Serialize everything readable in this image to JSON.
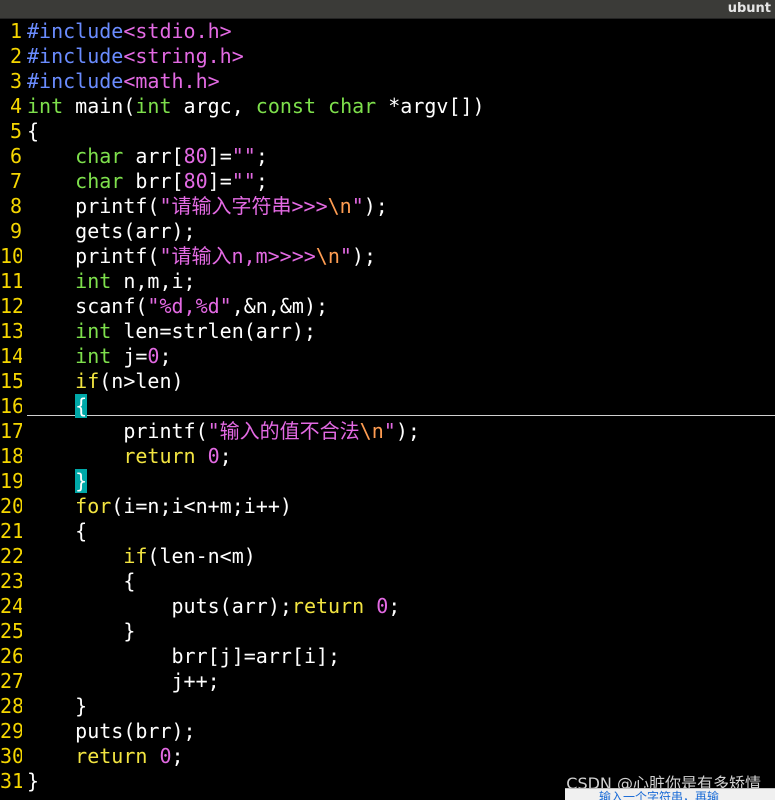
{
  "window": {
    "title": "ubunt"
  },
  "editor": {
    "lines": [
      {
        "num": "1",
        "tokens": [
          {
            "t": "pre",
            "v": "#include"
          },
          {
            "t": "inc",
            "v": "<stdio.h>"
          }
        ]
      },
      {
        "num": "2",
        "tokens": [
          {
            "t": "pre",
            "v": "#include"
          },
          {
            "t": "inc",
            "v": "<string.h>"
          }
        ]
      },
      {
        "num": "3",
        "tokens": [
          {
            "t": "pre",
            "v": "#include"
          },
          {
            "t": "inc",
            "v": "<math.h>"
          }
        ]
      },
      {
        "num": "4",
        "tokens": [
          {
            "t": "type",
            "v": "int"
          },
          {
            "t": "id",
            "v": " main("
          },
          {
            "t": "type",
            "v": "int"
          },
          {
            "t": "id",
            "v": " argc, "
          },
          {
            "t": "type",
            "v": "const char"
          },
          {
            "t": "id",
            "v": " *argv[])"
          }
        ]
      },
      {
        "num": "5",
        "tokens": [
          {
            "t": "id",
            "v": "{"
          }
        ]
      },
      {
        "num": "6",
        "tokens": [
          {
            "t": "id",
            "v": "    "
          },
          {
            "t": "type",
            "v": "char"
          },
          {
            "t": "id",
            "v": " arr["
          },
          {
            "t": "num",
            "v": "80"
          },
          {
            "t": "id",
            "v": "]="
          },
          {
            "t": "str",
            "v": "\"\""
          },
          {
            "t": "id",
            "v": ";"
          }
        ]
      },
      {
        "num": "7",
        "tokens": [
          {
            "t": "id",
            "v": "    "
          },
          {
            "t": "type",
            "v": "char"
          },
          {
            "t": "id",
            "v": " brr["
          },
          {
            "t": "num",
            "v": "80"
          },
          {
            "t": "id",
            "v": "]="
          },
          {
            "t": "str",
            "v": "\"\""
          },
          {
            "t": "id",
            "v": ";"
          }
        ]
      },
      {
        "num": "8",
        "tokens": [
          {
            "t": "id",
            "v": "    printf("
          },
          {
            "t": "str",
            "v": "\"请输入字符串>>>"
          },
          {
            "t": "esc",
            "v": "\\n"
          },
          {
            "t": "str",
            "v": "\""
          },
          {
            "t": "id",
            "v": ");"
          }
        ]
      },
      {
        "num": "9",
        "tokens": [
          {
            "t": "id",
            "v": "    gets(arr);"
          }
        ]
      },
      {
        "num": "10",
        "tokens": [
          {
            "t": "id",
            "v": "    printf("
          },
          {
            "t": "str",
            "v": "\"请输入n,m>>>>"
          },
          {
            "t": "esc",
            "v": "\\n"
          },
          {
            "t": "str",
            "v": "\""
          },
          {
            "t": "id",
            "v": ");"
          }
        ]
      },
      {
        "num": "11",
        "tokens": [
          {
            "t": "id",
            "v": "    "
          },
          {
            "t": "type",
            "v": "int"
          },
          {
            "t": "id",
            "v": " n,m,i;"
          }
        ]
      },
      {
        "num": "12",
        "tokens": [
          {
            "t": "id",
            "v": "    scanf("
          },
          {
            "t": "str",
            "v": "\"%d,%d\""
          },
          {
            "t": "id",
            "v": ",&n,&m);"
          }
        ]
      },
      {
        "num": "13",
        "tokens": [
          {
            "t": "id",
            "v": "    "
          },
          {
            "t": "type",
            "v": "int"
          },
          {
            "t": "id",
            "v": " len=strlen(arr);"
          }
        ]
      },
      {
        "num": "14",
        "tokens": [
          {
            "t": "id",
            "v": "    "
          },
          {
            "t": "type",
            "v": "int"
          },
          {
            "t": "id",
            "v": " j="
          },
          {
            "t": "num",
            "v": "0"
          },
          {
            "t": "id",
            "v": ";"
          }
        ]
      },
      {
        "num": "15",
        "tokens": [
          {
            "t": "id",
            "v": "    "
          },
          {
            "t": "kw",
            "v": "if"
          },
          {
            "t": "id",
            "v": "(n>len)"
          }
        ]
      },
      {
        "num": "16",
        "tokens": [
          {
            "t": "id",
            "v": "    "
          },
          {
            "t": "brace",
            "v": "{"
          }
        ]
      },
      {
        "num": "17",
        "tokens": [
          {
            "t": "id",
            "v": "        printf("
          },
          {
            "t": "str",
            "v": "\"输入的值不合法"
          },
          {
            "t": "esc",
            "v": "\\n"
          },
          {
            "t": "str",
            "v": "\""
          },
          {
            "t": "id",
            "v": ");"
          }
        ]
      },
      {
        "num": "18",
        "tokens": [
          {
            "t": "id",
            "v": "        "
          },
          {
            "t": "kw",
            "v": "return"
          },
          {
            "t": "id",
            "v": " "
          },
          {
            "t": "num",
            "v": "0"
          },
          {
            "t": "id",
            "v": ";"
          }
        ]
      },
      {
        "num": "19",
        "tokens": [
          {
            "t": "id",
            "v": "    "
          },
          {
            "t": "brace",
            "v": "}"
          }
        ]
      },
      {
        "num": "20",
        "tokens": [
          {
            "t": "id",
            "v": "    "
          },
          {
            "t": "kw",
            "v": "for"
          },
          {
            "t": "id",
            "v": "(i=n;i<n+m;i++)"
          }
        ]
      },
      {
        "num": "21",
        "tokens": [
          {
            "t": "id",
            "v": "    {"
          }
        ]
      },
      {
        "num": "22",
        "tokens": [
          {
            "t": "id",
            "v": "        "
          },
          {
            "t": "kw",
            "v": "if"
          },
          {
            "t": "id",
            "v": "(len-n<m)"
          }
        ]
      },
      {
        "num": "23",
        "tokens": [
          {
            "t": "id",
            "v": "        {"
          }
        ]
      },
      {
        "num": "24",
        "tokens": [
          {
            "t": "id",
            "v": "            puts(arr);"
          },
          {
            "t": "kw",
            "v": "return"
          },
          {
            "t": "id",
            "v": " "
          },
          {
            "t": "num",
            "v": "0"
          },
          {
            "t": "id",
            "v": ";"
          }
        ]
      },
      {
        "num": "25",
        "tokens": [
          {
            "t": "id",
            "v": "        }"
          }
        ]
      },
      {
        "num": "26",
        "tokens": [
          {
            "t": "id",
            "v": "            brr[j]=arr[i];"
          }
        ]
      },
      {
        "num": "27",
        "tokens": [
          {
            "t": "id",
            "v": "            j++;"
          }
        ]
      },
      {
        "num": "28",
        "tokens": [
          {
            "t": "id",
            "v": "    }"
          }
        ]
      },
      {
        "num": "29",
        "tokens": [
          {
            "t": "id",
            "v": "    puts(brr);"
          }
        ]
      },
      {
        "num": "30",
        "tokens": [
          {
            "t": "id",
            "v": "    "
          },
          {
            "t": "kw",
            "v": "return"
          },
          {
            "t": "id",
            "v": " "
          },
          {
            "t": "num",
            "v": "0"
          },
          {
            "t": "id",
            "v": ";"
          }
        ]
      },
      {
        "num": "31",
        "tokens": [
          {
            "t": "id",
            "v": "}"
          }
        ]
      }
    ]
  },
  "watermark": {
    "text": "CSDN @心脏你是有多矫情"
  },
  "popup": {
    "text": "输入一个字符串，再输"
  },
  "colors": {
    "background": "#000000",
    "line_number": "#f5d600",
    "preprocessor": "#6a8cff",
    "string": "#e36ae3",
    "type": "#7ee04c",
    "keyword": "#f2e441",
    "escape": "#ff9d52",
    "brace_highlight": "#00a8a8"
  }
}
